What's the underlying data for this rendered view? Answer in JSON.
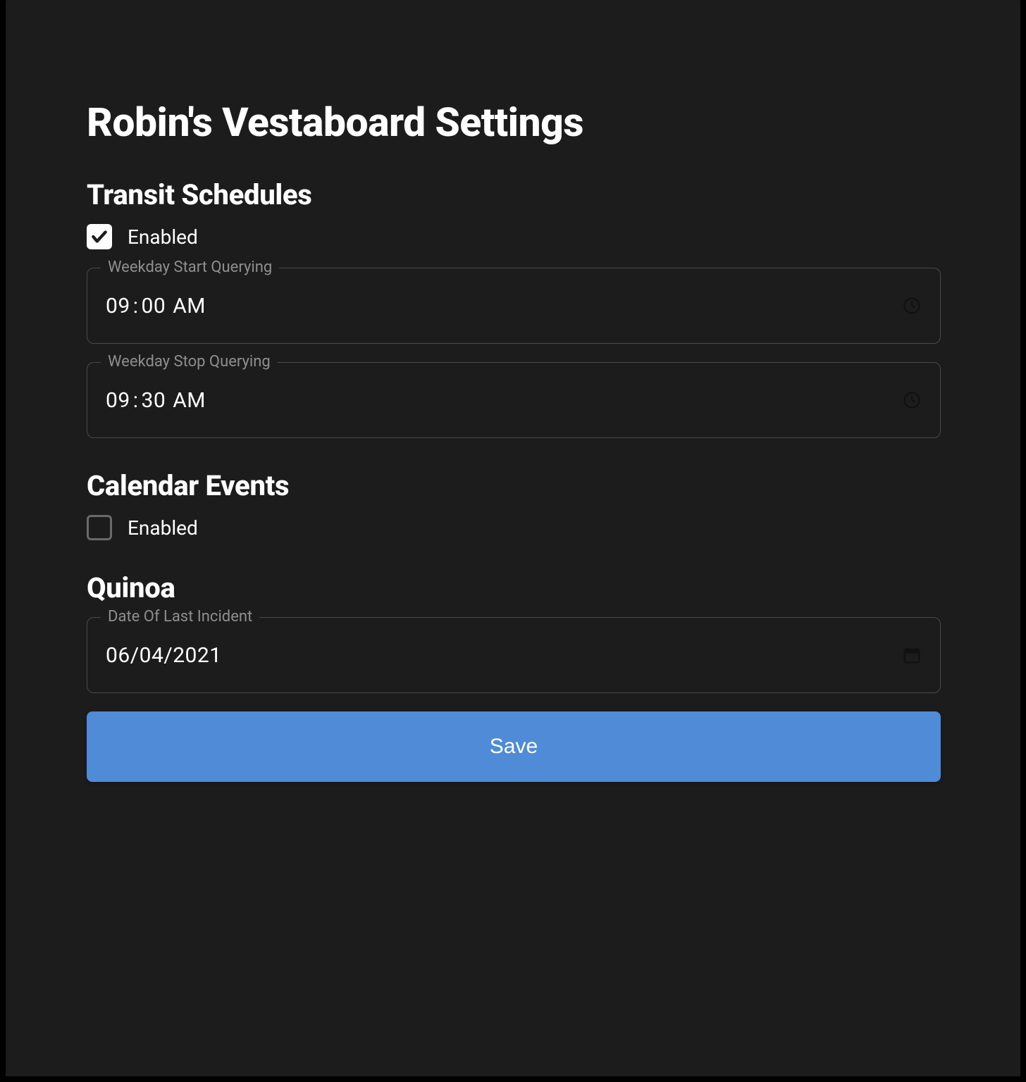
{
  "page_title": "Robin's Vestaboard Settings",
  "sections": {
    "transit": {
      "heading": "Transit Schedules",
      "enabled_label": "Enabled",
      "enabled_checked": true,
      "start_legend": "Weekday Start Querying",
      "start_hh": "09",
      "start_mm": "00",
      "start_ampm": "AM",
      "stop_legend": "Weekday Stop Querying",
      "stop_hh": "09",
      "stop_mm": "30",
      "stop_ampm": "AM"
    },
    "calendar": {
      "heading": "Calendar Events",
      "enabled_label": "Enabled",
      "enabled_checked": false
    },
    "quinoa": {
      "heading": "Quinoa",
      "date_legend": "Date Of Last Incident",
      "date_value": "06/04/2021"
    }
  },
  "save_label": "Save",
  "icons": {
    "clock": "clock-icon",
    "calendar": "calendar-icon",
    "check": "check-icon"
  },
  "colors": {
    "background": "#1c1c1d",
    "accent": "#4f8bd6",
    "border": "#4a4a4c",
    "muted_text": "#8e8e90"
  }
}
